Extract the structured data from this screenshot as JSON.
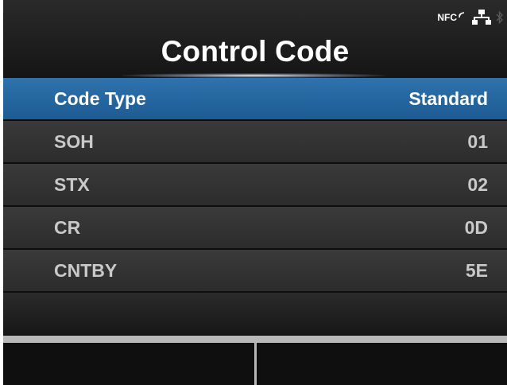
{
  "header": {
    "title": "Control Code",
    "nfc_label": "NFC",
    "icons": [
      "nfc-icon",
      "network-icon",
      "bluetooth-icon"
    ]
  },
  "rows": [
    {
      "label": "Code Type",
      "value": "Standard",
      "selected": true
    },
    {
      "label": "SOH",
      "value": "01"
    },
    {
      "label": "STX",
      "value": "02"
    },
    {
      "label": "CR",
      "value": "0D"
    },
    {
      "label": "CNTBY",
      "value": "5E"
    }
  ],
  "softkeys": [
    "",
    ""
  ],
  "colors": {
    "selected_row": "#2f72ad",
    "row": "#343434",
    "softkey_border": "#b9b9b9"
  }
}
